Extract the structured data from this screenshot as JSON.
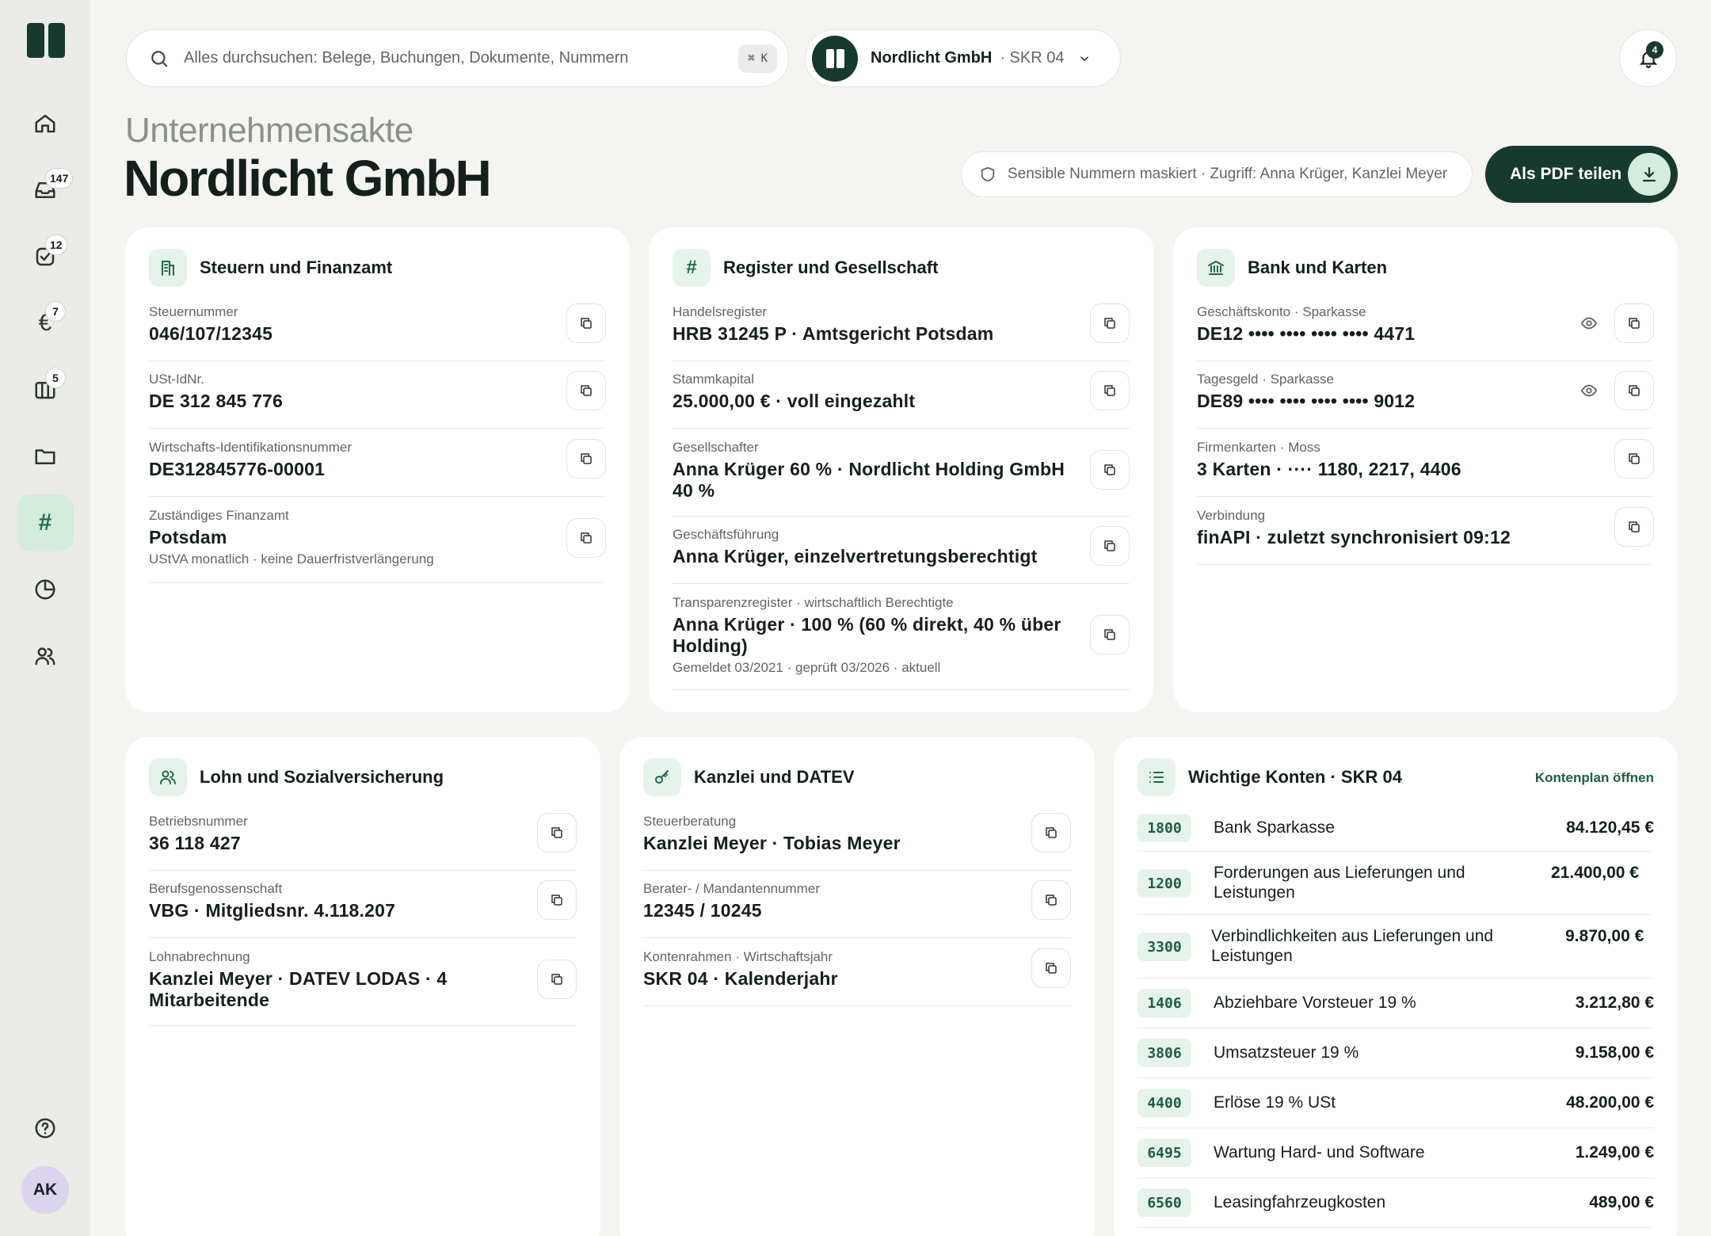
{
  "sidebar": {
    "badges": {
      "inbox": "147",
      "tasks": "12",
      "finance": "7",
      "columns": "5"
    },
    "avatar_initials": "AK",
    "active_icon": "#"
  },
  "search": {
    "placeholder": "Alles durchsuchen: Belege, Buchungen, Dokumente, Nummern",
    "shortcut_symbol": "⌘",
    "shortcut_key": "K"
  },
  "company_switcher": {
    "name": "Nordlicht GmbH",
    "chart": "· SKR 04"
  },
  "notifications": {
    "count": "4"
  },
  "header": {
    "eyebrow": "Unternehmensakte",
    "title": "Nordlicht GmbH",
    "privacy_note": "Sensible Nummern maskiert · Zugriff: Anna Krüger, Kanzlei Meyer",
    "pdf_button": "Als PDF teilen"
  },
  "cards": {
    "tax": {
      "title": "Steuern und Finanzamt",
      "fields": [
        {
          "label": "Steuernummer",
          "value": "046/107/12345"
        },
        {
          "label": "USt-IdNr.",
          "value": "DE 312 845 776"
        },
        {
          "label": "Wirtschafts-Identifikationsnummer",
          "value": "DE312845776-00001"
        },
        {
          "label": "Zuständiges Finanzamt",
          "value": "Potsdam",
          "sub": "UStVA monatlich · keine Dauerfristverlängerung"
        }
      ]
    },
    "register": {
      "title": "Register und Gesellschaft",
      "fields": [
        {
          "label": "Handelsregister",
          "value": "HRB 31245 P · Amtsgericht Potsdam"
        },
        {
          "label": "Stammkapital",
          "value": "25.000,00 € · voll eingezahlt"
        },
        {
          "label": "Gesellschafter",
          "value": "Anna Krüger 60 % · Nordlicht Holding GmbH 40 %"
        },
        {
          "label": "Geschäftsführung",
          "value": "Anna Krüger, einzelvertretungsberechtigt"
        },
        {
          "label": "Transparenzregister · wirtschaftlich Berechtigte",
          "value": "Anna Krüger · 100 % (60 % direkt, 40 % über Holding)",
          "sub": "Gemeldet 03/2021 · geprüft 03/2026 · aktuell"
        }
      ]
    },
    "bank": {
      "title": "Bank und Karten",
      "fields": [
        {
          "label": "Geschäftskonto · Sparkasse",
          "value": "DE12 •••• •••• •••• •••• 4471"
        },
        {
          "label": "Tagesgeld · Sparkasse",
          "value": "DE89 •••• •••• •••• •••• 9012"
        },
        {
          "label": "Firmenkarten · Moss",
          "value": "3 Karten · ···· 1180, 2217, 4406"
        },
        {
          "label": "Verbindung",
          "value": "finAPI · zuletzt synchronisiert 09:12"
        }
      ]
    },
    "payroll": {
      "title": "Lohn und Sozialversicherung",
      "fields": [
        {
          "label": "Betriebsnummer",
          "value": "36 118 427"
        },
        {
          "label": "Berufsgenossenschaft",
          "value": "VBG · Mitgliedsnr. 4.118.207"
        },
        {
          "label": "Lohnabrechnung",
          "value": "Kanzlei Meyer · DATEV LODAS · 4 Mitarbeitende"
        }
      ]
    },
    "datev": {
      "title": "Kanzlei und DATEV",
      "fields": [
        {
          "label": "Steuerberatung",
          "value": "Kanzlei Meyer · Tobias Meyer"
        },
        {
          "label": "Berater- / Mandantennummer",
          "value": "12345 / 10245"
        },
        {
          "label": "Kontenrahmen · Wirtschaftsjahr",
          "value": "SKR 04 · Kalenderjahr"
        }
      ]
    },
    "accounts": {
      "title": "Wichtige Konten · SKR 04",
      "link": "Kontenplan öffnen",
      "rows": [
        {
          "number": "1800",
          "name": "Bank Sparkasse",
          "amount": "84.120,45 €"
        },
        {
          "number": "1200",
          "name": "Forderungen aus Lieferungen und Leistungen",
          "amount": "21.400,00 €"
        },
        {
          "number": "3300",
          "name": "Verbindlichkeiten aus Lieferungen und Leistungen",
          "amount": "9.870,00 €"
        },
        {
          "number": "1406",
          "name": "Abziehbare Vorsteuer 19 %",
          "amount": "3.212,80 €"
        },
        {
          "number": "3806",
          "name": "Umsatzsteuer 19 %",
          "amount": "9.158,00 €"
        },
        {
          "number": "4400",
          "name": "Erlöse 19 % USt",
          "amount": "48.200,00 €"
        },
        {
          "number": "6495",
          "name": "Wartung Hard- und Software",
          "amount": "1.249,00 €"
        },
        {
          "number": "6560",
          "name": "Leasingfahrzeugkosten",
          "amount": "489,00 €"
        }
      ]
    }
  }
}
